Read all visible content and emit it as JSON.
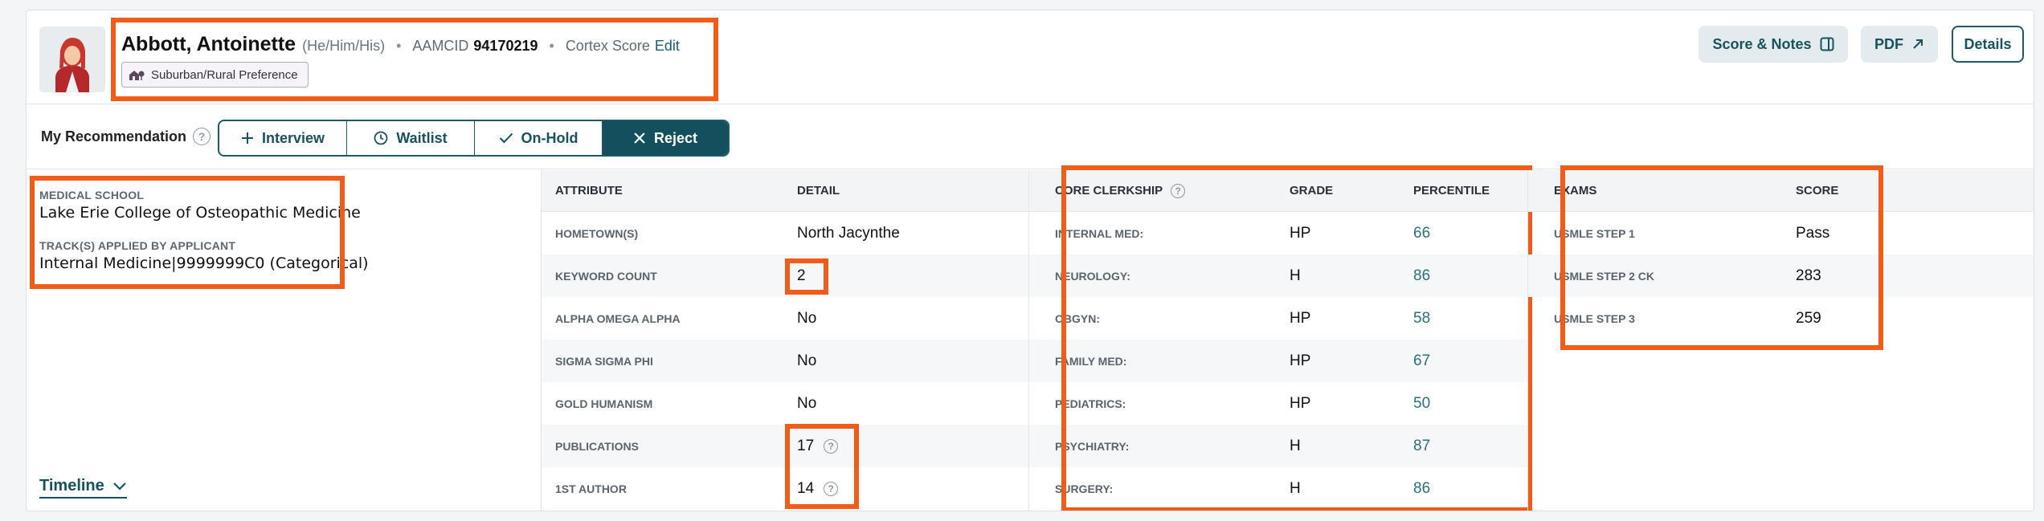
{
  "applicant": {
    "name": "Abbott, Antoinette",
    "pronouns": "(He/Him/His)",
    "aamcid_label": "AAMCID",
    "aamcid": "94170219",
    "cortex_label": "Cortex Score",
    "edit_label": "Edit",
    "preference_badge": "Suburban/Rural Preference"
  },
  "header_buttons": {
    "score_notes": "Score & Notes",
    "pdf": "PDF",
    "details": "Details"
  },
  "recommendation": {
    "label": "My Recommendation",
    "options": [
      {
        "label": "Interview",
        "icon": "plus-icon",
        "active": false
      },
      {
        "label": "Waitlist",
        "icon": "clock-icon",
        "active": false
      },
      {
        "label": "On-Hold",
        "icon": "check-icon",
        "active": false
      },
      {
        "label": "Reject",
        "icon": "x-icon",
        "active": true
      }
    ]
  },
  "school": {
    "medical_school_label": "MEDICAL SCHOOL",
    "medical_school": "Lake Erie College of Osteopathic Medicine",
    "tracks_label": "TRACK(S) APPLIED BY APPLICANT",
    "tracks": "Internal Medicine|9999999C0 (Categorical)"
  },
  "timeline_label": "Timeline",
  "attributes": {
    "headers": [
      "ATTRIBUTE",
      "DETAIL"
    ],
    "rows": [
      {
        "attribute": "HOMETOWN(S)",
        "detail": "North Jacynthe",
        "help": false
      },
      {
        "attribute": "KEYWORD COUNT",
        "detail": "2",
        "help": false
      },
      {
        "attribute": "ALPHA OMEGA ALPHA",
        "detail": "No",
        "help": false
      },
      {
        "attribute": "SIGMA SIGMA PHI",
        "detail": "No",
        "help": false
      },
      {
        "attribute": "GOLD HUMANISM",
        "detail": "No",
        "help": false
      },
      {
        "attribute": "PUBLICATIONS",
        "detail": "17",
        "help": true
      },
      {
        "attribute": "1ST AUTHOR",
        "detail": "14",
        "help": true
      }
    ]
  },
  "clerkships": {
    "headers": [
      "CORE CLERKSHIP",
      "GRADE",
      "PERCENTILE"
    ],
    "rows": [
      {
        "name": "INTERNAL MED:",
        "grade": "HP",
        "percentile": "66"
      },
      {
        "name": "NEUROLOGY:",
        "grade": "H",
        "percentile": "86"
      },
      {
        "name": "OBGYN:",
        "grade": "HP",
        "percentile": "58"
      },
      {
        "name": "FAMILY MED:",
        "grade": "HP",
        "percentile": "67"
      },
      {
        "name": "PEDIATRICS:",
        "grade": "HP",
        "percentile": "50"
      },
      {
        "name": "PSYCHIATRY:",
        "grade": "H",
        "percentile": "87"
      },
      {
        "name": "SURGERY:",
        "grade": "H",
        "percentile": "86"
      }
    ]
  },
  "exams": {
    "headers": [
      "EXAMS",
      "SCORE"
    ],
    "rows": [
      {
        "name": "USMLE STEP 1",
        "score": "Pass"
      },
      {
        "name": "USMLE STEP 2 CK",
        "score": "283"
      },
      {
        "name": "USMLE STEP 3",
        "score": "259"
      }
    ]
  },
  "colors": {
    "accent": "#134f5c",
    "highlight": "#f25c19",
    "percentile": "#2d6f7a"
  }
}
